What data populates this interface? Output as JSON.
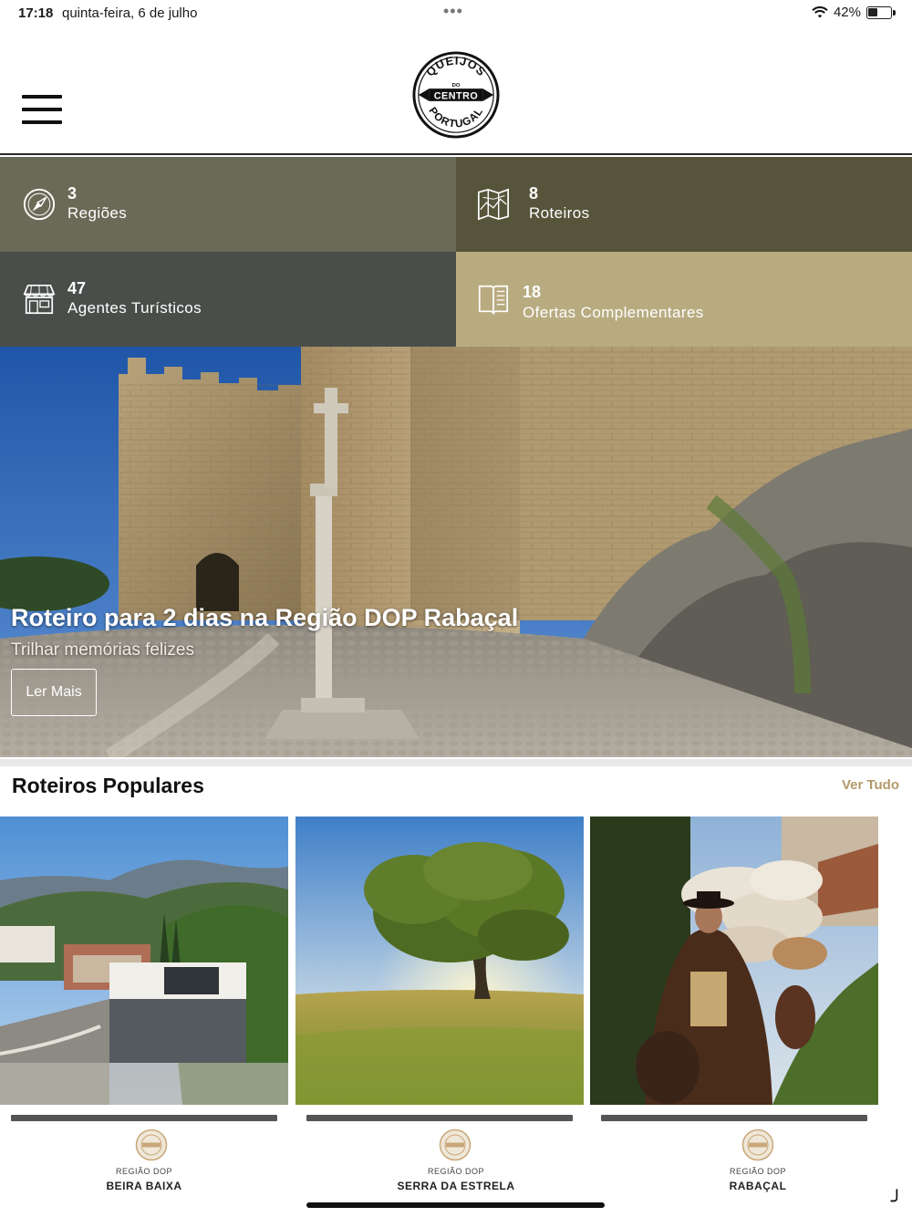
{
  "status_bar": {
    "time": "17:18",
    "date": "quinta-feira, 6 de julho",
    "battery": "42%",
    "battery_level": 0.42
  },
  "header": {
    "logo_text": [
      "QUEIJOS",
      "DO",
      "CENTRO",
      "PORTUGAL"
    ]
  },
  "stats": [
    {
      "count": "3",
      "label": "Regiões",
      "icon": "compass-icon",
      "color": "#6b6a57"
    },
    {
      "count": "8",
      "label": "Roteiros",
      "icon": "map-icon",
      "color": "#56553b"
    },
    {
      "count": "47",
      "label": "Agentes Turísticos",
      "icon": "store-icon",
      "color": "#4a4e4a"
    },
    {
      "count": "18",
      "label": "Ofertas Complementares",
      "icon": "book-icon",
      "color": "#b8ab80"
    }
  ],
  "hero": {
    "title": "Roteiro para 2 dias na Região DOP Rabaçal",
    "subtitle": "Trilhar memórias felizes",
    "button_label": "Ler Mais"
  },
  "popular": {
    "title": "Roteiros Populares",
    "see_all": "Ver Tudo",
    "routes": [
      {
        "prefix": "REGIÃO DOP",
        "name": "BEIRA BAIXA"
      },
      {
        "prefix": "REGIÃO DOP",
        "name": "SERRA DA ESTRELA"
      },
      {
        "prefix": "REGIÃO DOP",
        "name": "RABAÇAL"
      }
    ]
  },
  "colors": {
    "accent": "#b39a6a",
    "header_border": "#2a2a2a"
  }
}
